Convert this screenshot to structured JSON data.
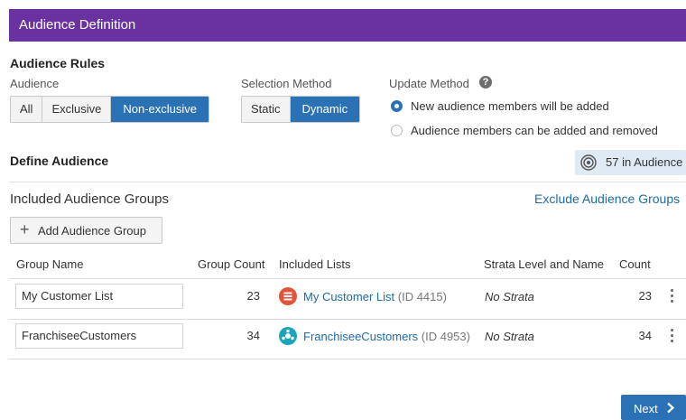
{
  "header": {
    "title": "Audience Definition"
  },
  "rules": {
    "heading": "Audience Rules",
    "audience": {
      "label": "Audience",
      "options": [
        "All",
        "Exclusive",
        "Non-exclusive"
      ],
      "selected": "Non-exclusive"
    },
    "selection_method": {
      "label": "Selection Method",
      "options": [
        "Static",
        "Dynamic"
      ],
      "selected": "Dynamic"
    },
    "update_method": {
      "label": "Update Method",
      "help": "?",
      "options": [
        "New audience members will be added",
        "Audience members can be added and removed"
      ],
      "selected": "New audience members will be added"
    }
  },
  "define": {
    "heading": "Define Audience",
    "count_badge": "57 in Audience",
    "included_heading": "Included Audience Groups",
    "exclude_link": "Exclude Audience Groups",
    "add_button": "Add Audience Group",
    "add_button_icon": "+"
  },
  "table": {
    "headers": [
      "Group Name",
      "Group Count",
      "Included Lists",
      "Strata Level and Name",
      "Count"
    ],
    "rows": [
      {
        "group_name": "My Customer List",
        "group_count": "23",
        "list_name": "My Customer List",
        "list_id": "(ID 4415)",
        "strata": "No Strata",
        "count": "23",
        "icon_color": "#e2533a"
      },
      {
        "group_name": "FranchiseeCustomers",
        "group_count": "34",
        "list_name": "FranchiseeCustomers",
        "list_id": "(ID 4953)",
        "strata": "No Strata",
        "count": "34",
        "icon_color": "#1aa6b8"
      }
    ]
  },
  "footer": {
    "next_label": "Next"
  }
}
